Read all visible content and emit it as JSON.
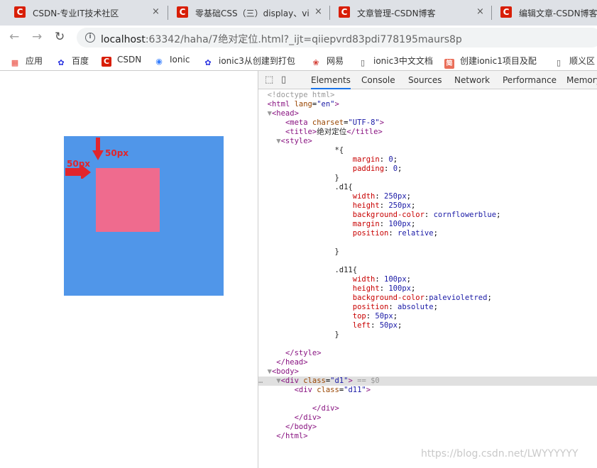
{
  "tabs": [
    {
      "icon": "C",
      "title": "CSDN-专业IT技术社区"
    },
    {
      "icon": "C",
      "title": "零基础CSS（三）display、vis"
    },
    {
      "icon": "C",
      "title": "文章管理-CSDN博客"
    },
    {
      "icon": "C",
      "title": "编辑文章-CSDN博客"
    }
  ],
  "tab_close": "×",
  "address": {
    "host": "localhost",
    "rest": ":63342/haha/7绝对定位.html?_ijt=qiiepvrd83pdi778195maurs8p",
    "info_glyph": "i"
  },
  "nav": {
    "back": "←",
    "forward": "→",
    "reload": "↻"
  },
  "bookmarks": [
    {
      "icon": "apps-icon",
      "label": "应用",
      "glyph": "▦",
      "color": "#e94235"
    },
    {
      "icon": "baidu-icon",
      "label": "百度",
      "glyph": "✿",
      "color": "#2932e1"
    },
    {
      "icon": "csdn-icon",
      "label": "CSDN",
      "glyph": "C",
      "color": "#d81e06"
    },
    {
      "icon": "ionic-icon",
      "label": "Ionic",
      "glyph": "◉",
      "color": "#3880ff"
    },
    {
      "icon": "baidu-icon",
      "label": "ionic3从创建到打包",
      "glyph": "✿",
      "color": "#2932e1"
    },
    {
      "icon": "netease-icon",
      "label": "网易",
      "glyph": "❀",
      "color": "#d33a31"
    },
    {
      "icon": "doc-icon",
      "label": "ionic3中文文档",
      "glyph": "▯",
      "color": "#555555"
    },
    {
      "icon": "jianshu-icon",
      "label": "创建ionic1项目及配",
      "glyph": "简",
      "color": "#ea6f5a"
    },
    {
      "icon": "doc-icon",
      "label": "顺义区",
      "glyph": "▯",
      "color": "#555555"
    }
  ],
  "demo": {
    "label_top": "50px",
    "label_left": "50px",
    "outer_color": "#5096e9",
    "inner_color": "#ef6b8e",
    "arrow_color": "#e1252c"
  },
  "devtools": {
    "tabs": [
      "Elements",
      "Console",
      "Sources",
      "Network",
      "Performance",
      "Memory"
    ],
    "active": "Elements"
  },
  "watermark": "https://blog.csdn.net/LWYYYYYY"
}
